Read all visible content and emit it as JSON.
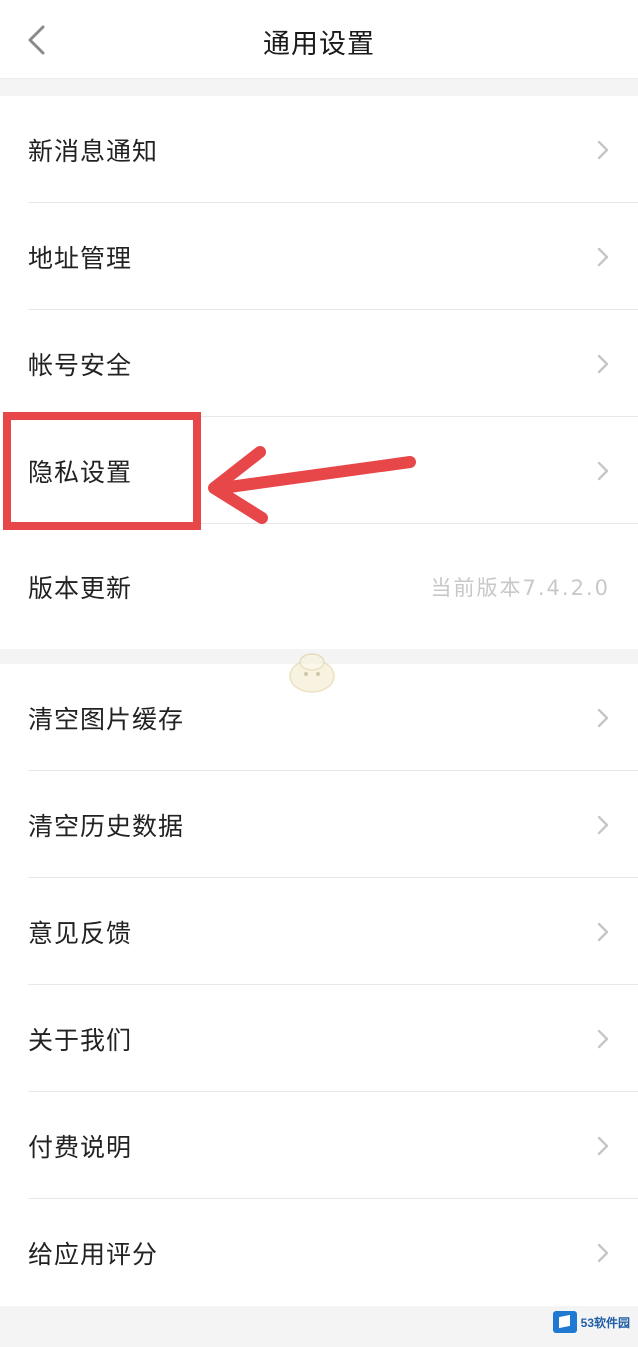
{
  "header": {
    "title": "通用设置",
    "back_icon": "chevron-left-icon"
  },
  "group1": {
    "items": [
      {
        "label": "新消息通知"
      },
      {
        "label": "地址管理"
      },
      {
        "label": "帐号安全"
      },
      {
        "label": "隐私设置",
        "highlighted": true
      },
      {
        "label": "版本更新",
        "value": "当前版本7.4.2.0"
      }
    ]
  },
  "group2": {
    "items": [
      {
        "label": "清空图片缓存"
      },
      {
        "label": "清空历史数据"
      },
      {
        "label": "意见反馈"
      },
      {
        "label": "关于我们"
      },
      {
        "label": "付费说明"
      },
      {
        "label": "给应用评分"
      }
    ]
  },
  "annotation": {
    "highlight_color": "#e8474a",
    "arrow_color": "#e8474a"
  },
  "watermark": {
    "text": "53软件园"
  }
}
